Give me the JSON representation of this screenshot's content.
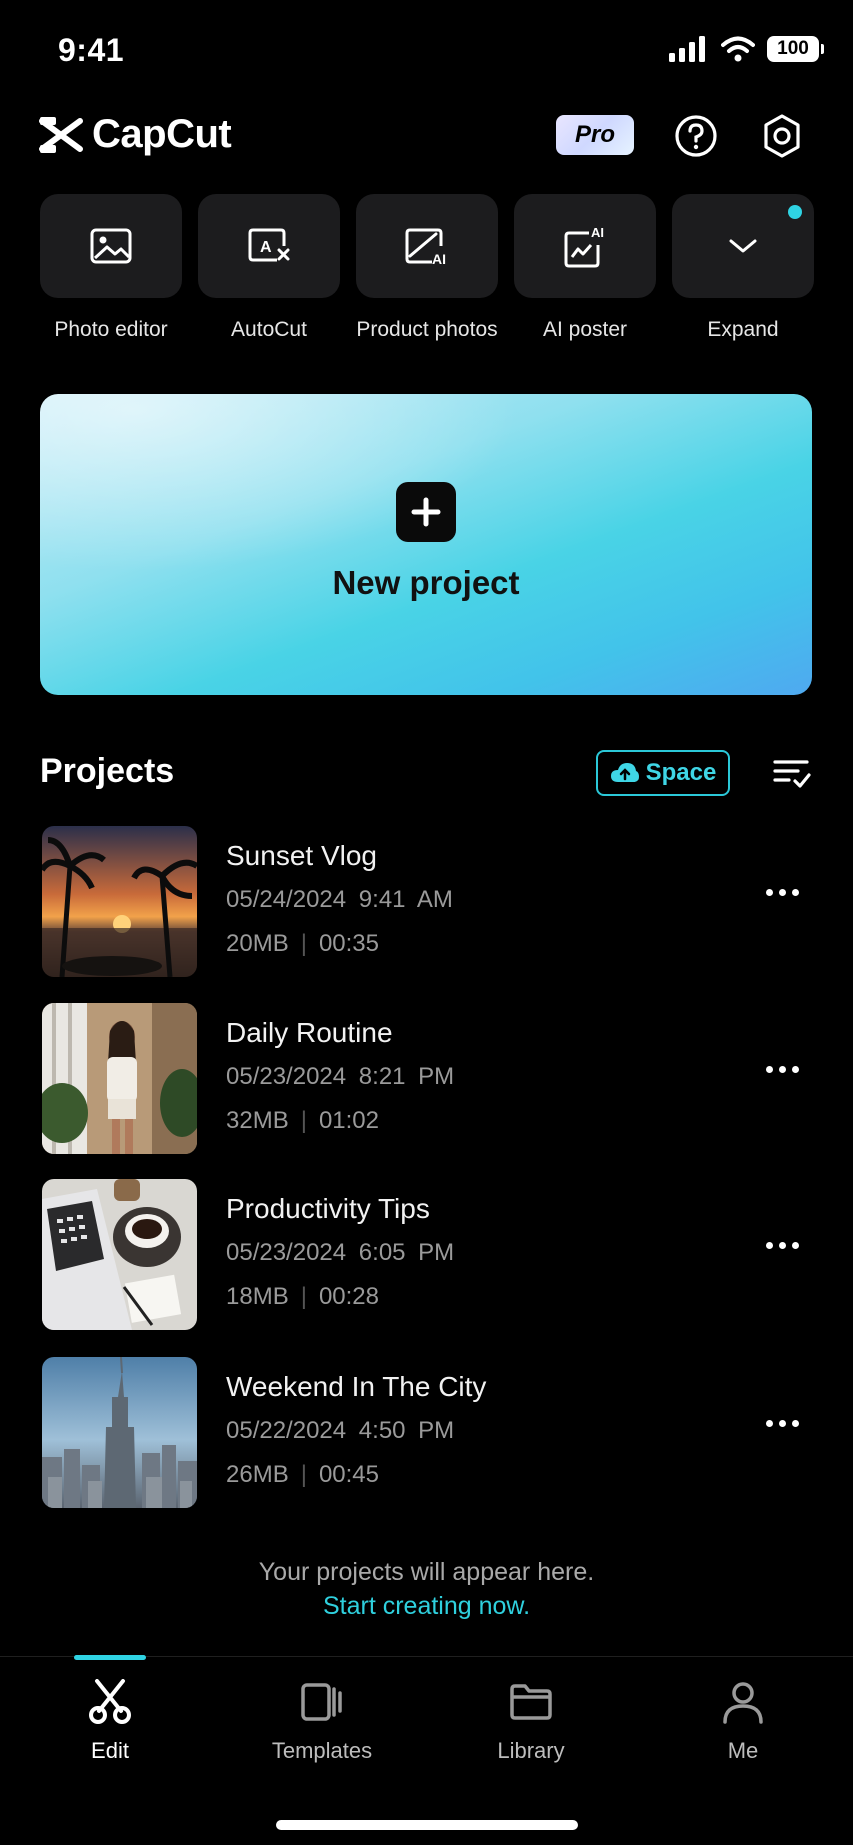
{
  "status_bar": {
    "time": "9:41",
    "battery": "100"
  },
  "header": {
    "app_name": "CapCut",
    "pro_label": "Pro"
  },
  "tools": [
    {
      "label": "Photo editor",
      "icon": "image-icon"
    },
    {
      "label": "AutoCut",
      "icon": "autocut-icon"
    },
    {
      "label": "Product photos",
      "icon": "product-photo-ai-icon"
    },
    {
      "label": "AI poster",
      "icon": "ai-poster-icon"
    },
    {
      "label": "Expand",
      "icon": "chevron-down-icon"
    }
  ],
  "new_project": {
    "label": "New project"
  },
  "projects": {
    "title": "Projects",
    "space_label": "Space",
    "items": [
      {
        "title": "Sunset Vlog",
        "date": "05/24/2024",
        "time": "9:41 AM",
        "size": "20MB",
        "duration": "00:35"
      },
      {
        "title": "Daily Routine",
        "date": "05/23/2024",
        "time": "8:21 PM",
        "size": "32MB",
        "duration": "01:02"
      },
      {
        "title": "Productivity Tips",
        "date": "05/23/2024",
        "time": "6:05 PM",
        "size": "18MB",
        "duration": "00:28"
      },
      {
        "title": "Weekend In The City",
        "date": "05/22/2024",
        "time": "4:50 PM",
        "size": "26MB",
        "duration": "00:45"
      }
    ]
  },
  "empty_hint": {
    "line1": "Your projects will appear here.",
    "line2": "Start creating now."
  },
  "tabs": [
    {
      "label": "Edit",
      "icon": "scissors-icon",
      "active": true
    },
    {
      "label": "Templates",
      "icon": "templates-icon",
      "active": false
    },
    {
      "label": "Library",
      "icon": "folder-icon",
      "active": false
    },
    {
      "label": "Me",
      "icon": "person-icon",
      "active": false
    }
  ],
  "colors": {
    "accent": "#2fd3e3",
    "background": "#000000",
    "tile": "#1c1c1e"
  }
}
